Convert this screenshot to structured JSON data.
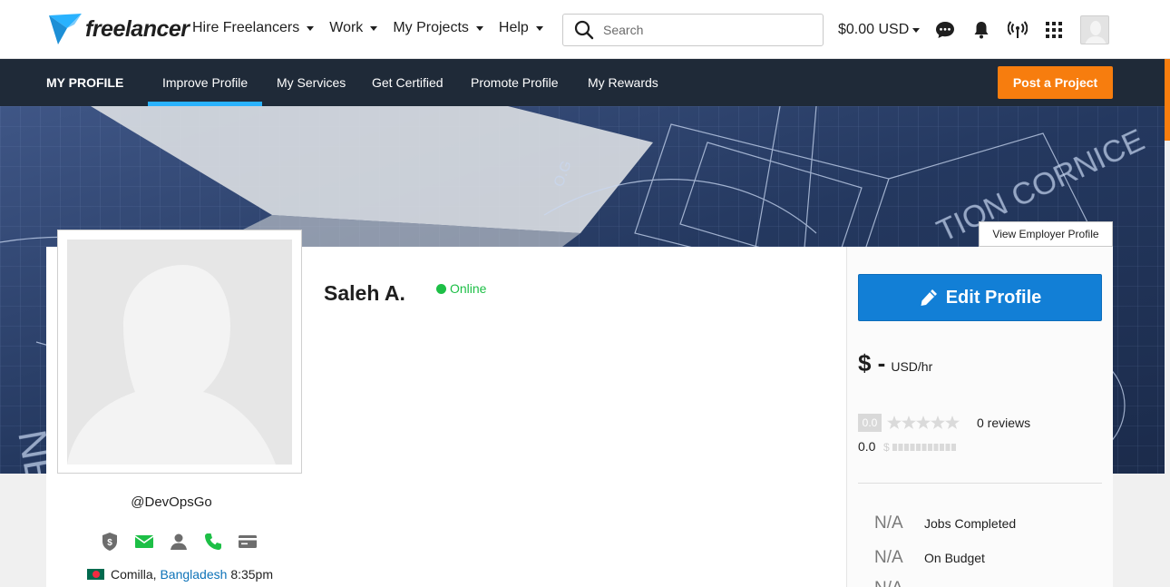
{
  "brand": {
    "name": "freelancer",
    "accent": "#29b2fe",
    "primary": "#127fd6",
    "cta": "#f77d0e",
    "navy": "#1f2a38"
  },
  "topnav": {
    "items": [
      {
        "label": "Hire Freelancers"
      },
      {
        "label": "Work"
      },
      {
        "label": "My Projects"
      },
      {
        "label": "Help"
      }
    ],
    "search_placeholder": "Search",
    "balance": "$0.00 USD",
    "icons": [
      "messages-icon",
      "notifications-icon",
      "live-feed-icon",
      "apps-grid-icon"
    ]
  },
  "subnav": {
    "title": "MY PROFILE",
    "tabs": [
      {
        "label": "Improve Profile",
        "active": true
      },
      {
        "label": "My Services"
      },
      {
        "label": "Get Certified"
      },
      {
        "label": "Promote Profile"
      },
      {
        "label": "My Rewards"
      }
    ],
    "cta": "Post a Project"
  },
  "profile": {
    "view_employer": "View Employer Profile",
    "name": "Saleh A.",
    "status": "Online",
    "username": "@DevOpsGo",
    "city": "Comilla,",
    "country": "Bangladesh",
    "local_time": "8:35pm",
    "verifications": [
      "payment-verified-icon",
      "email-verified-icon",
      "identity-icon",
      "phone-verified-icon",
      "card-icon"
    ]
  },
  "sidebar": {
    "edit_label": "Edit Profile",
    "rate_amount": "$ -",
    "rate_unit": "USD/hr",
    "rating": "0.0",
    "stars": 0,
    "reviews": "0 reviews",
    "earnings_score": "0.0",
    "stats": [
      {
        "value": "N/A",
        "label": "Jobs Completed"
      },
      {
        "value": "N/A",
        "label": "On Budget"
      },
      {
        "value": "N/A",
        "label": ""
      }
    ]
  }
}
